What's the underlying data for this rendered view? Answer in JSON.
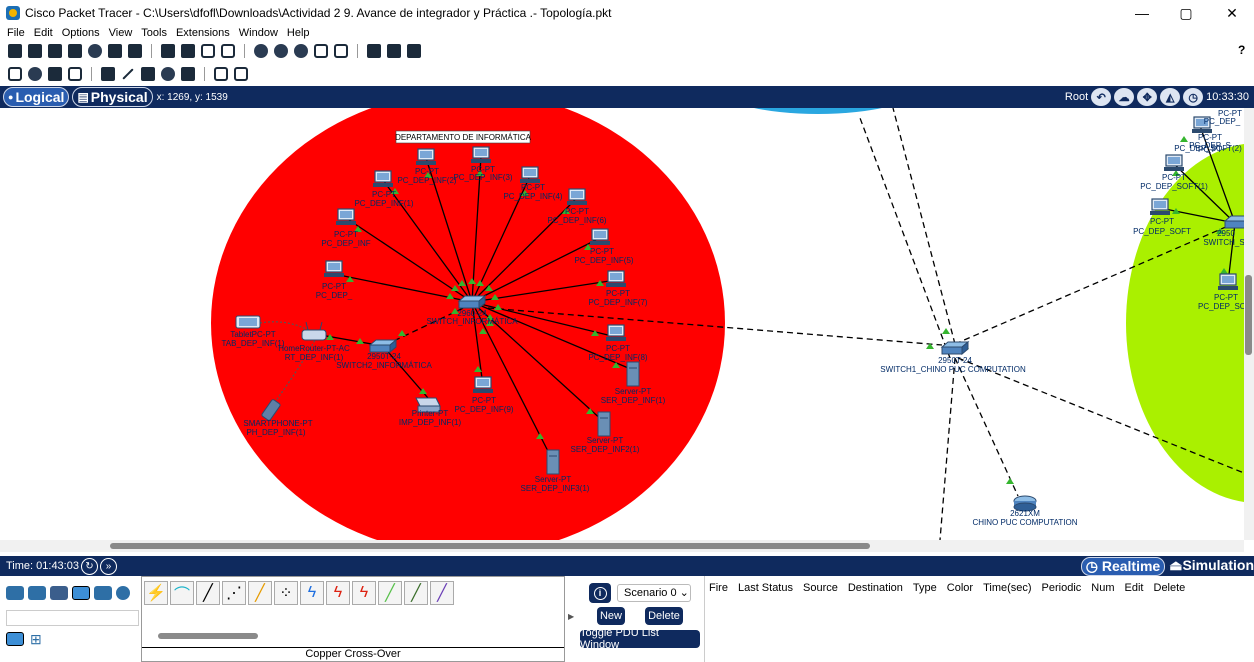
{
  "window": {
    "title": "Cisco Packet Tracer - C:\\Users\\dfofl\\Downloads\\Actividad 2 9. Avance de integrador y Práctica .- Topología.pkt",
    "minimize": "—",
    "maximize": "▢",
    "close": "✕"
  },
  "menu": [
    "File",
    "Edit",
    "Options",
    "View",
    "Tools",
    "Extensions",
    "Window",
    "Help"
  ],
  "toolbar": {
    "help": "?"
  },
  "modebar": {
    "logical": "Logical",
    "physical": "Physical",
    "coords": "x: 1269, y: 1539",
    "root": "Root",
    "clock": "10:33:30"
  },
  "topology": {
    "zone_title": "DEPARTAMENTO DE INFORMÁTICA",
    "central_switch": {
      "model": "2960-24",
      "name": "SWITCH_INFORMÁTICA"
    },
    "switch2": {
      "model": "2950T-24",
      "name": "SWITCH2_INFORMÁTICA"
    },
    "pcs": [
      {
        "type": "PC-PT",
        "name": "PC_DEP_INF(2)"
      },
      {
        "type": "PC-PT",
        "name": "PC_DEP_INF(3)"
      },
      {
        "type": "PC-PT",
        "name": "PC_DEP_INF(1)"
      },
      {
        "type": "PC-PT",
        "name": "PC_DEP_INF(4)"
      },
      {
        "type": "PC-PT",
        "name": "PC_DEP_INF(6)"
      },
      {
        "type": "PC-PT",
        "name": "PC_DEP_INF"
      },
      {
        "type": "PC-PT",
        "name": "PC_DEP_INF(5)"
      },
      {
        "type": "PC-PT",
        "name": "PC_DEP_"
      },
      {
        "type": "PC-PT",
        "name": "PC_DEP_INF(7)"
      },
      {
        "type": "PC-PT",
        "name": "PC_DEP_INF(8)"
      },
      {
        "type": "PC-PT",
        "name": "PC_DEP_INF(9)"
      }
    ],
    "servers": [
      {
        "type": "Server-PT",
        "name": "SER_DEP_INF(1)"
      },
      {
        "type": "Server-PT",
        "name": "SER_DEP_INF2(1)"
      },
      {
        "type": "Server-PT",
        "name": "SER_DEP_INF3(1)"
      }
    ],
    "tablet": {
      "type": "TabletPC-PT",
      "name": "TAB_DEP_INF(1)"
    },
    "router": {
      "type": "HomeRouter-PT-AC",
      "name": "RT_DEP_INF(1)"
    },
    "phone": {
      "type": "SMARTPHONE-PT",
      "name": "PH_DEP_INF(1)"
    },
    "printer": {
      "type": "Printer-PT",
      "name": "IMP_DEP_INF(1)"
    },
    "core_switch": {
      "model": "2950T-24",
      "name": "SWITCH1_CHINO PUC COMPUTATION"
    },
    "core_router": {
      "model": "2621XM",
      "name": "CHINO PUC COMPUTATION"
    },
    "soft_switch": {
      "model": "2950",
      "name": "SWITCH_S"
    },
    "soft_pcs": [
      {
        "type": "PC-PT",
        "name": "PC_DEP_S"
      },
      {
        "type": "PC-PT",
        "name": "PC_DEP_SOFT(2)"
      },
      {
        "type": "PC-PT",
        "name": "PC_DEP_SOFT(1)"
      },
      {
        "type": "PC-PT",
        "name": "PC_DEP_SOFT"
      },
      {
        "type": "PC-PT",
        "name": "PC_DEP_SO"
      }
    ],
    "soft_pc_top": {
      "type": "PC-PT",
      "name": "PC_DEP_"
    }
  },
  "status": {
    "time": "Time: 01:43:03",
    "realtime": "Realtime",
    "simulation": "Simulation"
  },
  "bottom": {
    "connection_label": "Copper Cross-Over",
    "scenario": "Scenario 0",
    "new": "New",
    "delete": "Delete",
    "toggle": "Toggle PDU List Window",
    "columns": [
      "Fire",
      "Last Status",
      "Source",
      "Destination",
      "Type",
      "Color",
      "Time(sec)",
      "Periodic",
      "Num",
      "Edit",
      "Delete"
    ]
  },
  "colors": {
    "zone_red": "#ff0000",
    "zone_green": "#aaf000",
    "zone_blue": "#2aa7e0",
    "navy": "#0f2a5e"
  }
}
